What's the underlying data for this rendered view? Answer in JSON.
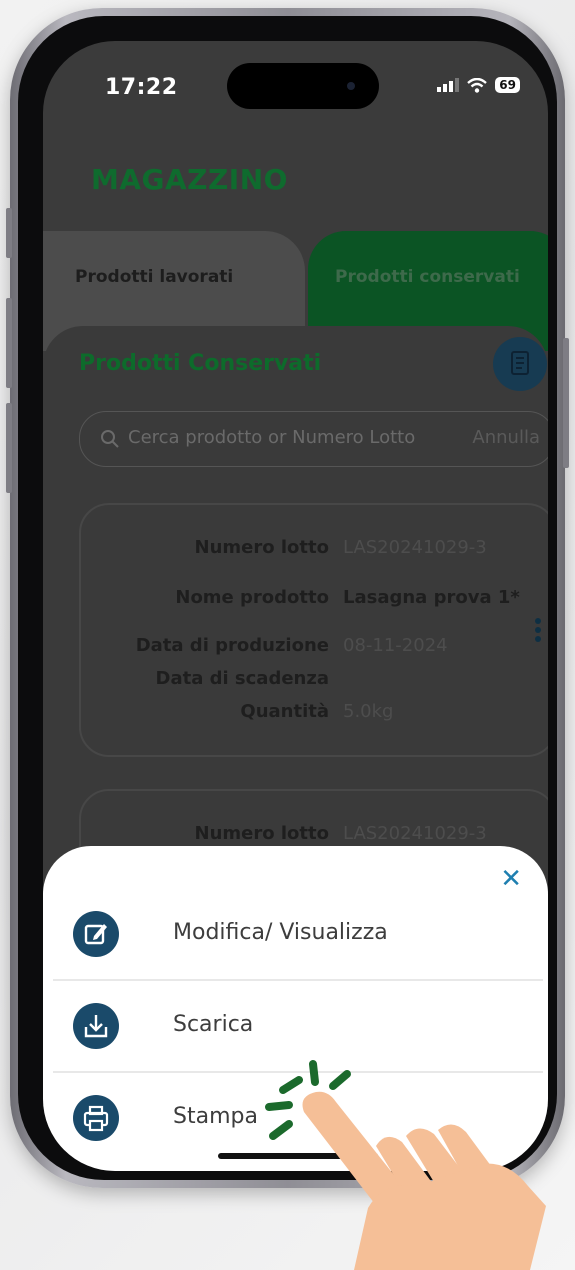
{
  "status_bar": {
    "time": "17:22",
    "battery": "69"
  },
  "app": {
    "title": "MAGAZZINO"
  },
  "tabs": [
    {
      "label": "Prodotti lavorati"
    },
    {
      "label": "Prodotti conservati"
    }
  ],
  "section": {
    "title": "Prodotti Conservati"
  },
  "search": {
    "placeholder": "Cerca prodotto or Numero Lotto",
    "cancel_label": "Annulla"
  },
  "cards": [
    {
      "lot_label": "Numero lotto",
      "lot_value": "LAS20241029-3",
      "name_label": "Nome prodotto",
      "name_value": "Lasagna prova 1*",
      "prod_label": "Data di produzione",
      "prod_value": "08-11-2024",
      "exp_label": "Data di scadenza",
      "exp_value": "",
      "qty_label": "Quantità",
      "qty_value": "5.0kg"
    },
    {
      "lot_label": "Numero lotto",
      "lot_value": "LAS20241029-3"
    }
  ],
  "sheet": {
    "options": [
      {
        "label": "Modifica/ Visualizza",
        "icon": "edit-icon"
      },
      {
        "label": "Scarica",
        "icon": "download-icon"
      },
      {
        "label": "Stampa",
        "icon": "printer-icon"
      }
    ]
  },
  "colors": {
    "brand_green": "#0f6b2e",
    "icon_blue": "#1a4a6a",
    "hand_skin": "#f5bf97",
    "tap_rays": "#1b6a2c"
  }
}
